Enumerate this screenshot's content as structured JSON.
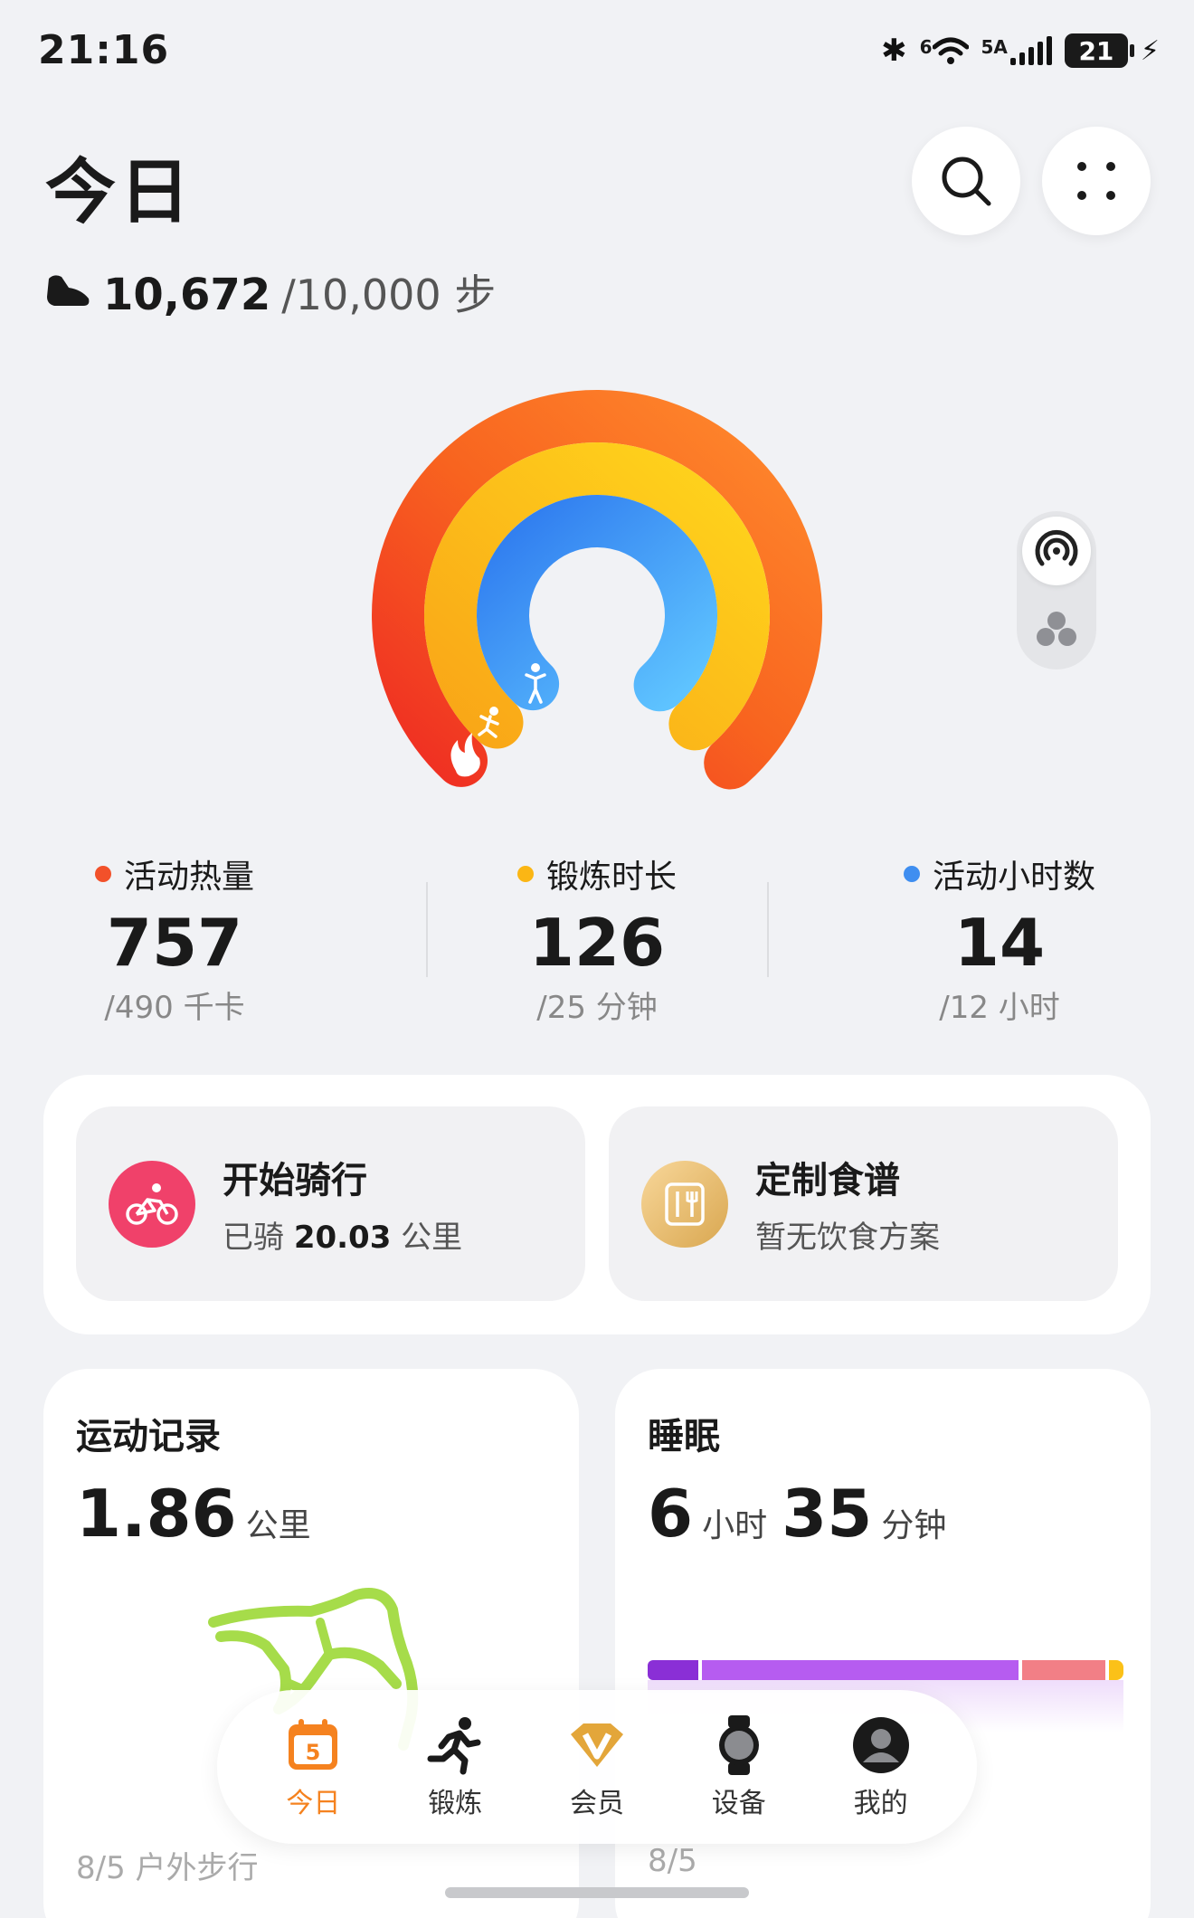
{
  "status_bar": {
    "time": "21:16",
    "network_label": "5A",
    "wifi_label": "6",
    "battery_level": "21"
  },
  "header": {
    "title": "今日"
  },
  "steps": {
    "current": "10,672",
    "goal": "/10,000 步"
  },
  "rings": {
    "calories_progress": 1.54,
    "exercise_progress": 5.04,
    "active_hours_progress": 1.17,
    "colors": {
      "calories": "#f2512a",
      "exercise": "#fbb614",
      "active_hours": "#3f8ef0"
    }
  },
  "stats": [
    {
      "label": "活动热量",
      "value": "757",
      "goal": "/490 千卡",
      "color": "#f2512a"
    },
    {
      "label": "锻炼时长",
      "value": "126",
      "goal": "/25 分钟",
      "color": "#fbb614"
    },
    {
      "label": "活动小时数",
      "value": "14",
      "goal": "/12 小时",
      "color": "#3f8ef0"
    }
  ],
  "quick_actions": {
    "cycling": {
      "title": "开始骑行",
      "sub_prefix": "已骑",
      "distance": "20.03",
      "sub_unit": "公里"
    },
    "diet": {
      "title": "定制食谱",
      "sub": "暂无饮食方案"
    }
  },
  "exercise_card": {
    "title": "运动记录",
    "value": "1.86",
    "unit": "公里",
    "date": "8/5 户外步行"
  },
  "sleep_card": {
    "title": "睡眠",
    "hours": "6",
    "hours_unit": "小时",
    "minutes": "35",
    "minutes_unit": "分钟",
    "date": "8/5"
  },
  "nav": {
    "items": [
      {
        "label": "今日",
        "icon": "calendar-icon",
        "badge": "5",
        "active": true
      },
      {
        "label": "锻炼",
        "icon": "runner-icon",
        "active": false
      },
      {
        "label": "会员",
        "icon": "vip-icon",
        "active": false
      },
      {
        "label": "设备",
        "icon": "watch-icon",
        "active": false
      },
      {
        "label": "我的",
        "icon": "profile-icon",
        "active": false
      }
    ]
  }
}
